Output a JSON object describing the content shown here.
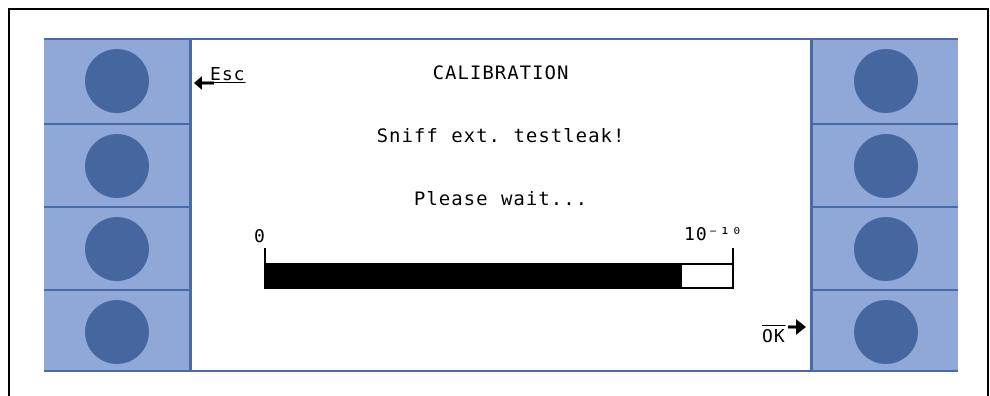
{
  "screen": {
    "title": "CALIBRATION",
    "message": "Sniff ext. testleak!",
    "status": "Please wait...",
    "esc_label": "Esc",
    "ok_label": "OK"
  },
  "progress": {
    "min_label": "0",
    "max_label": "10⁻¹⁰",
    "fill_fraction": 0.893
  },
  "softkeys": {
    "left": [
      "",
      "",
      "",
      ""
    ],
    "right": [
      "",
      "",
      "",
      ""
    ]
  },
  "colors": {
    "panel": "#8fa8d8",
    "panel_border": "#4a6aa6",
    "button": "#45669f"
  }
}
